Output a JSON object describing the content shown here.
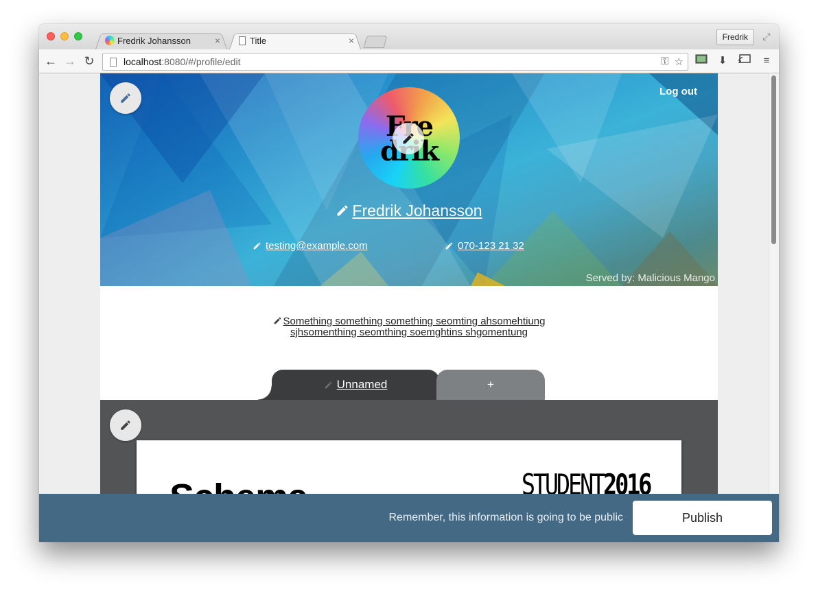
{
  "browser": {
    "tabs": [
      {
        "title": "Fredrik Johansson",
        "close": "×"
      },
      {
        "title": "Title",
        "close": "×"
      }
    ],
    "profile_button": "Fredrik",
    "url_host": "localhost",
    "url_rest": ":8080/#/profile/edit",
    "nav": {
      "back": "←",
      "forward": "→",
      "reload": "↻"
    },
    "icons": {
      "key": "⚿",
      "star": "☆",
      "download": "⬇",
      "cast": "⎘",
      "menu": "≡",
      "fullscreen": "⤢"
    }
  },
  "hero": {
    "logout_label": "Log out",
    "avatar_text_1": "Fre",
    "avatar_text_2": "drik",
    "name": "Fredrik Johansson",
    "email": "testing@example.com",
    "phone": "070-123 21 32",
    "served_by": "Served by: Malicious Mango"
  },
  "description": {
    "line1": "Something something something seomting ahsomehtiung",
    "line2": "sjhsomenthing seomthing soemghtins shgomentung"
  },
  "profile_tabs": {
    "active_label": "Unnamed",
    "add_label": "+"
  },
  "card": {
    "left_text": "Schema",
    "right_text_a": "STUDENT",
    "right_text_b": "2016"
  },
  "footer": {
    "note": "Remember, this information is going to be public",
    "publish_label": "Publish"
  },
  "colors": {
    "footer_bg": "#446985",
    "dark_section": "#525456",
    "active_tab": "#3b3c3e",
    "add_tab": "#7e8183"
  }
}
